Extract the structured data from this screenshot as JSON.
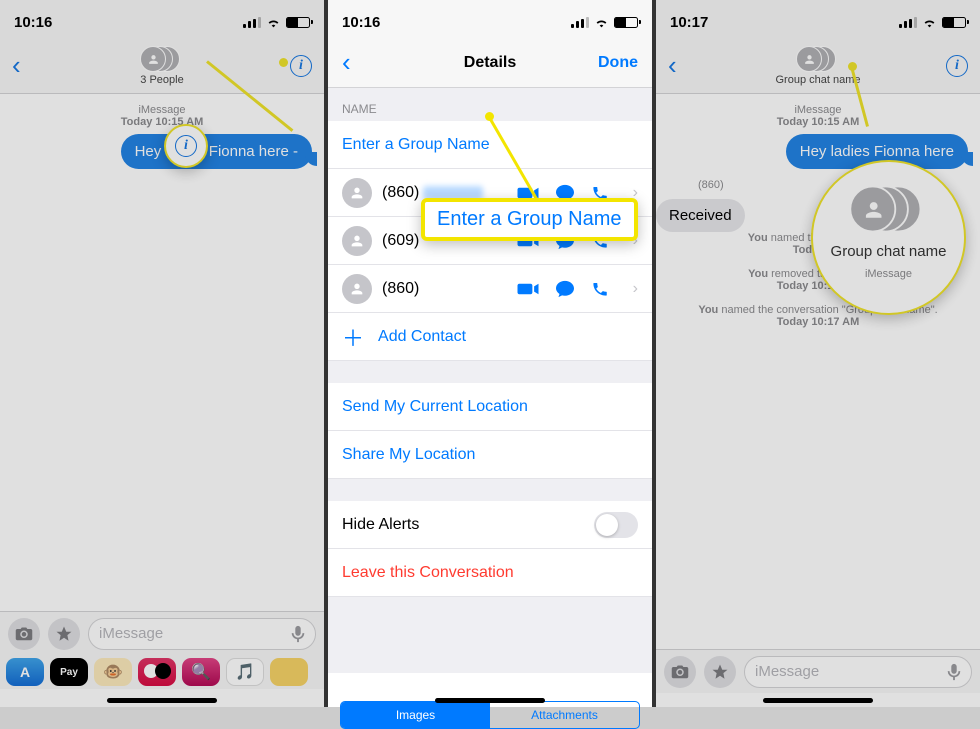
{
  "panel1": {
    "status_time": "10:16",
    "header_subtitle": "3 People",
    "ts_label": "iMessage",
    "ts_time": "Today 10:15 AM",
    "msg_out": "Hey ladies Fionna here -",
    "compose_placeholder": "iMessage"
  },
  "panel2": {
    "status_time": "10:16",
    "title": "Details",
    "done": "Done",
    "name_section": "NAME",
    "name_placeholder": "Enter a Group Name",
    "contacts": [
      "(860)",
      "(609)",
      "(860)"
    ],
    "add_contact": "Add Contact",
    "send_location": "Send My Current Location",
    "share_location": "Share My Location",
    "hide_alerts": "Hide Alerts",
    "leave": "Leave this Conversation",
    "seg_images": "Images",
    "seg_attachments": "Attachments",
    "callout_label": "Enter a Group Name"
  },
  "panel3": {
    "status_time": "10:17",
    "header_subtitle": "Group chat name",
    "ts_label": "iMessage",
    "ts_time": "Today 10:15 AM",
    "msg_out": "Hey ladies Fionna here",
    "sender": "(860)",
    "msg_in": "Received",
    "sys1_a": "You",
    "sys1_b": " named the conversation",
    "sys1_time": "Today 10:",
    "sys2_a": "You",
    "sys2_b": " removed the name from",
    "sys2_time": "Today 10:16 AM",
    "sys3_a": "You",
    "sys3_b": " named the conversation \"Group chat name\".",
    "sys3_time": "Today 10:17 AM",
    "compose_placeholder": "iMessage",
    "callout_label": "Group chat name",
    "callout_sub": "iMessage"
  }
}
